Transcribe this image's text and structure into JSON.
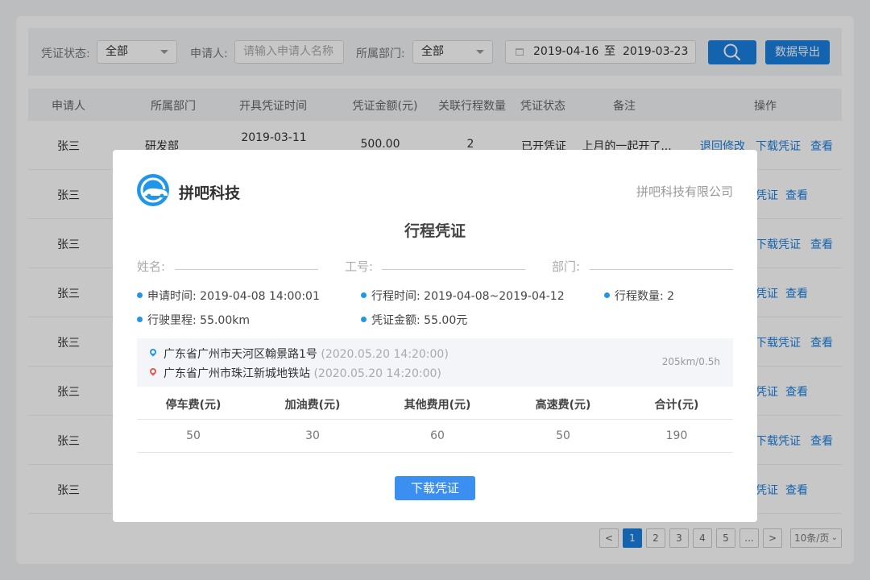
{
  "filters": {
    "status_label": "凭证状态:",
    "status_value": "全部",
    "applicant_label": "申请人:",
    "applicant_placeholder": "请输入申请人名称",
    "dept_label": "所属部门:",
    "dept_value": "全部",
    "date_from": "2019-04-16",
    "date_sep": "至",
    "date_to": "2019-03-23",
    "export_label": "数据导出"
  },
  "table": {
    "headers": [
      "申请人",
      "所属部门",
      "开具凭证时间",
      "凭证金额(元)",
      "关联行程数量",
      "凭证状态",
      "备注",
      "操作"
    ],
    "first_row": {
      "applicant": "张三",
      "dept": "研发部",
      "time": "2019-03-11",
      "amount": "500.00",
      "trips": "2",
      "status": "已开凭证",
      "note": "上月的一起开了...",
      "actions": [
        "退回修改",
        "下载凭证",
        "查看"
      ]
    },
    "rows": [
      {
        "applicant": "张三",
        "actions": [
          "凭证",
          "查看"
        ]
      },
      {
        "applicant": "张三",
        "actions": [
          "下载凭证",
          "查看"
        ]
      },
      {
        "applicant": "张三",
        "actions": [
          "凭证",
          "查看"
        ]
      },
      {
        "applicant": "张三",
        "actions": [
          "下载凭证",
          "查看"
        ]
      },
      {
        "applicant": "张三",
        "actions": [
          "凭证",
          "查看"
        ]
      },
      {
        "applicant": "张三",
        "actions": [
          "下载凭证",
          "查看"
        ]
      },
      {
        "applicant": "张三",
        "actions": [
          "凭证",
          "查看"
        ]
      }
    ]
  },
  "pagination": {
    "prev": "<",
    "pages": [
      "1",
      "2",
      "3",
      "4",
      "5",
      "..."
    ],
    "current": 1,
    "next": ">",
    "page_size": "10条/页"
  },
  "modal": {
    "brand": "拼吧科技",
    "company": "拼吧科技有限公司",
    "title": "行程凭证",
    "name_label": "姓名:",
    "id_label": "工号:",
    "dept_label": "部门:",
    "apply_time": "申请时间: 2019-04-08  14:00:01",
    "trip_time": "行程时间: 2019-04-08~2019-04-12",
    "trip_count": "行程数量: 2",
    "mileage": "行驶里程: 55.00km",
    "amount": "凭证金额: 55.00元",
    "route_from": "广东省广州市天河区翰景路1号",
    "route_from_time": "(2020.05.20 14:20:00)",
    "route_to": "广东省广州市珠江新城地铁站",
    "route_to_time": "(2020.05.20 14:20:00)",
    "route_speed": "205km/0.5h",
    "fee_headers": [
      "停车费(元)",
      "加油费(元)",
      "其他费用(元)",
      "高速费(元)",
      "合计(元)"
    ],
    "fee_values": [
      "50",
      "30",
      "60",
      "50",
      "190"
    ],
    "download_label": "下载凭证"
  },
  "colors": {
    "accent": "#1a7fe0",
    "pin_start": "#2196e8",
    "pin_end": "#e65a4f"
  }
}
